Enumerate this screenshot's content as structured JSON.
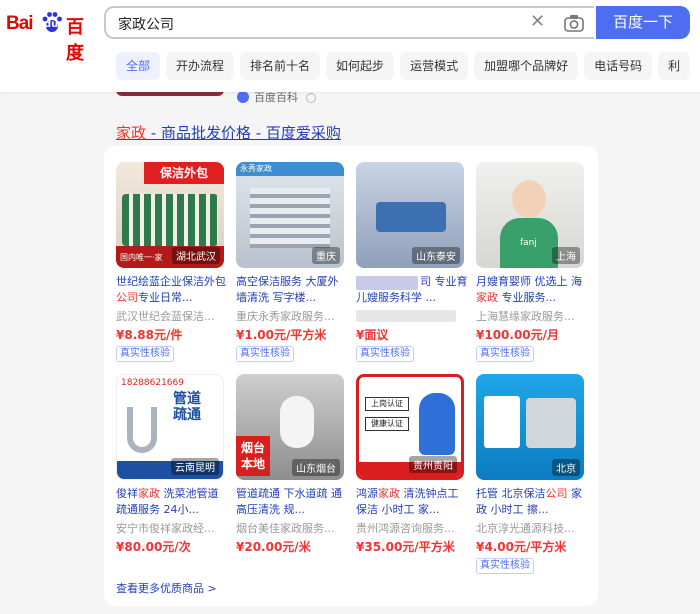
{
  "logo": {
    "text_en": "Bai",
    "text_du": "du",
    "text_cn": "百度"
  },
  "search": {
    "query": "家政公司",
    "button_label": "百度一下"
  },
  "tags": [
    "全部",
    "开办流程",
    "排名前十名",
    "如何起步",
    "运营模式",
    "加盟哪个品牌好",
    "电话号码",
    "利"
  ],
  "top_result": {
    "source": "百度百科"
  },
  "result": {
    "title_hl": "家政",
    "title_rest": " - 商品批发价格 - 百度爱采购"
  },
  "products": [
    {
      "loc": "湖北武汉",
      "desc_a": "世纪绘蓝企业保洁外包",
      "desc_hl": "公司",
      "desc_b": "专业日常...",
      "shop": "武汉世纪会蓝保洁...",
      "price": "¥8.88元/件",
      "badge": "真实性核验",
      "img_text": "保洁外包",
      "img_sub": "国内唯一·家"
    },
    {
      "loc": "重庆",
      "desc_a": "高空保洁服务 大厦外墙清洗 写字楼...",
      "desc_hl": "",
      "desc_b": "",
      "shop": "重庆永秀家政服务...",
      "price": "¥1.00元/平方米",
      "badge": "真实性核验",
      "img_text": "永秀家政",
      "img_sub": ""
    },
    {
      "loc": "山东泰安",
      "desc_a": "",
      "desc_hl": "",
      "desc_b": "司 专业育儿嫂服务科学 ...",
      "shop": "",
      "price": "¥面议",
      "badge": "真实性核验",
      "img_text": "",
      "img_sub": ""
    },
    {
      "loc": "上海",
      "desc_a": "月嫂育婴师 优选上 海",
      "desc_hl": "家政",
      "desc_b": " 专业服务...",
      "shop": "上海慧缘家政服务...",
      "price": "¥100.00元/月",
      "badge": "真实性核验",
      "img_text": "fanj",
      "img_sub": ""
    },
    {
      "loc": "云南昆明",
      "desc_a": "俊祥",
      "desc_hl": "家政",
      "desc_b": " 洗菜池管道疏通服务 24小...",
      "shop": "安宁市俊祥家政经...",
      "price": "¥80.00元/次",
      "badge": "",
      "img_text": "管道疏通",
      "img_sub": "18288621669"
    },
    {
      "loc": "山东烟台",
      "desc_a": "管道疏通 下水道疏 通高压清洗 规...",
      "desc_hl": "",
      "desc_b": "",
      "shop": "烟台美佳家政服务...",
      "price": "¥20.00元/米",
      "badge": "",
      "img_text": "烟台本地",
      "img_sub": ""
    },
    {
      "loc": "贵州贵阳",
      "desc_a": "鸿源",
      "desc_hl": "家政",
      "desc_b": " 清洗钟点工保洁 小时工 家...",
      "shop": "贵州鸿源咨询服务...",
      "price": "¥35.00元/平方米",
      "badge": "",
      "img_text": "上岗认证",
      "img_sub": "健康认证"
    },
    {
      "loc": "北京",
      "desc_a": "托管 北京保洁",
      "desc_hl": "公司",
      "desc_b": " 家政 小时工 擦...",
      "shop": "北京淳光通源科技...",
      "price": "¥4.00元/平方米",
      "badge": "真实性核验",
      "img_text": "",
      "img_sub": ""
    }
  ],
  "more_link": "查看更多优质商品 >",
  "colors": {
    "brand_blue": "#4e6ef2",
    "brand_red": "#e10602",
    "link": "#2440b3",
    "price": "#f73131"
  }
}
